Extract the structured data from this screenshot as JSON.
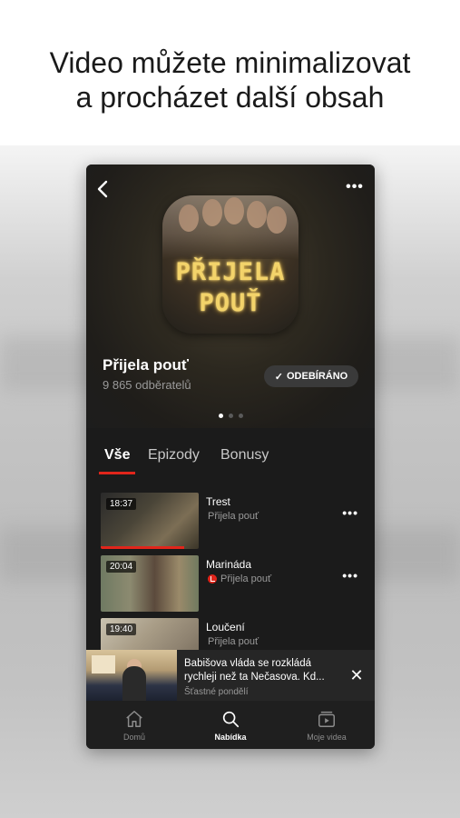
{
  "headline": {
    "line1": "Video můžete minimalizovat",
    "line2": "a procházet další obsah"
  },
  "header": {
    "back_icon": "chevron-left-icon",
    "more_label": "•••"
  },
  "poster": {
    "line1": "PŘIJELA",
    "line2": "POUŤ"
  },
  "show": {
    "title": "Přijela pouť",
    "subscribers": "9 865 odběratelů",
    "subscribe_label": "ODEBÍRÁNO",
    "subscribe_check": "✓"
  },
  "tabs": [
    {
      "label": "Vše",
      "active": true
    },
    {
      "label": "Epizody",
      "active": false
    },
    {
      "label": "Bonusy",
      "active": false
    }
  ],
  "episodes": [
    {
      "duration": "18:37",
      "title": "Trest",
      "channel": "Přijela pouť",
      "badge": false,
      "progress": 0.85
    },
    {
      "duration": "20:04",
      "title": "Marináda",
      "channel": "Přijela pouť",
      "badge": true,
      "progress": 0
    },
    {
      "duration": "19:40",
      "title": "Loučení",
      "channel": "Přijela pouť",
      "badge": false,
      "progress": 0
    }
  ],
  "episode_more": "•••",
  "mini_player": {
    "title": "Babišova vláda se rozkládá rychleji než ta Nečasova. Kd...",
    "subtitle": "Šťastné pondělí",
    "close": "✕"
  },
  "bottom_nav": [
    {
      "label": "Domů",
      "icon": "home-icon",
      "active": false
    },
    {
      "label": "Nabídka",
      "icon": "search-icon",
      "active": true
    },
    {
      "label": "Moje videa",
      "icon": "play-folder-icon",
      "active": false
    }
  ],
  "colors": {
    "accent": "#e1251b",
    "background": "#1b1b1b"
  }
}
